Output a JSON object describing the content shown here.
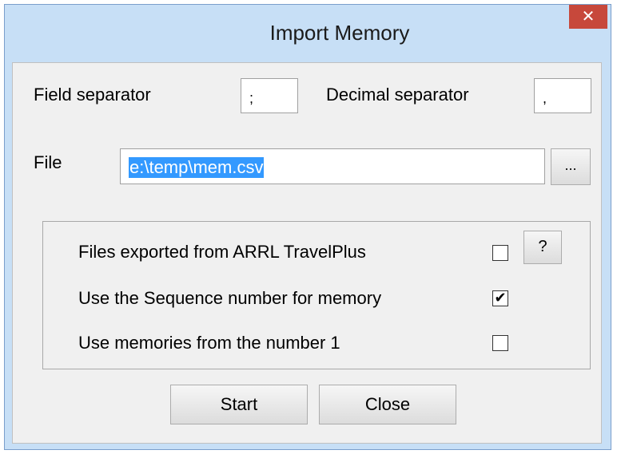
{
  "window": {
    "title": "Import Memory",
    "close_glyph": "✕"
  },
  "fields": {
    "field_separator_label": "Field separator",
    "field_separator_value": ";",
    "decimal_separator_label": "Decimal separator",
    "decimal_separator_value": ",",
    "file_label": "File",
    "file_value": "e:\\temp\\mem.csv",
    "browse_label": "..."
  },
  "options": {
    "help_label": "?",
    "items": [
      {
        "label": "Files exported from ARRL TravelPlus",
        "checked": false,
        "mark": ""
      },
      {
        "label": "Use the Sequence number for memory",
        "checked": true,
        "mark": "✔"
      },
      {
        "label": "Use memories from the number 1",
        "checked": false,
        "mark": ""
      }
    ]
  },
  "buttons": {
    "start_label": "Start",
    "close_label": "Close"
  },
  "colors": {
    "frame": "#c7dff6",
    "client": "#f0f0f0",
    "close_button": "#c7483b",
    "selection": "#3399ff"
  }
}
